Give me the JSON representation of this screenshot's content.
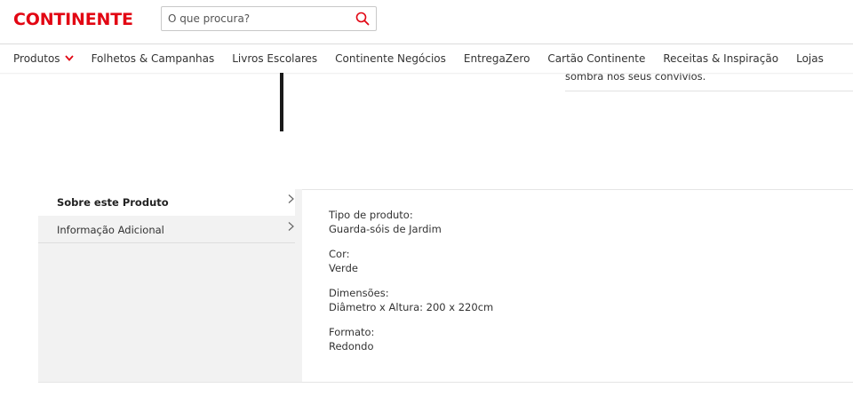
{
  "header": {
    "logo_text": "CONTINENTE",
    "search": {
      "placeholder": "O que procura?"
    },
    "colors": {
      "brand": "#e20613",
      "text": "#333333",
      "panel": "#f2f2f2"
    }
  },
  "nav": {
    "items": [
      {
        "label": "Produtos",
        "has_dropdown": true
      },
      {
        "label": "Folhetos & Campanhas"
      },
      {
        "label": "Livros Escolares"
      },
      {
        "label": "Continente Negócios"
      },
      {
        "label": "EntregaZero"
      },
      {
        "label": "Cartão Continente"
      },
      {
        "label": "Receitas & Inspiração"
      },
      {
        "label": "Lojas"
      }
    ]
  },
  "product": {
    "description_tail": "sombra nos seus convívios."
  },
  "details": {
    "tabs": [
      {
        "label": "Sobre este Produto",
        "active": true
      },
      {
        "label": "Informação Adicional",
        "active": false
      }
    ],
    "specs": [
      {
        "label": "Tipo de produto:",
        "value": "Guarda-sóis de Jardim"
      },
      {
        "label": "Cor:",
        "value": "Verde"
      },
      {
        "label": "Dimensões:",
        "value": "Diâmetro x Altura: 200 x 220cm"
      },
      {
        "label": "Formato:",
        "value": "Redondo"
      }
    ]
  },
  "icons": {
    "search": "search-icon",
    "dropdown": "chevron-down-icon",
    "tab_arrow": "chevron-right-icon"
  }
}
